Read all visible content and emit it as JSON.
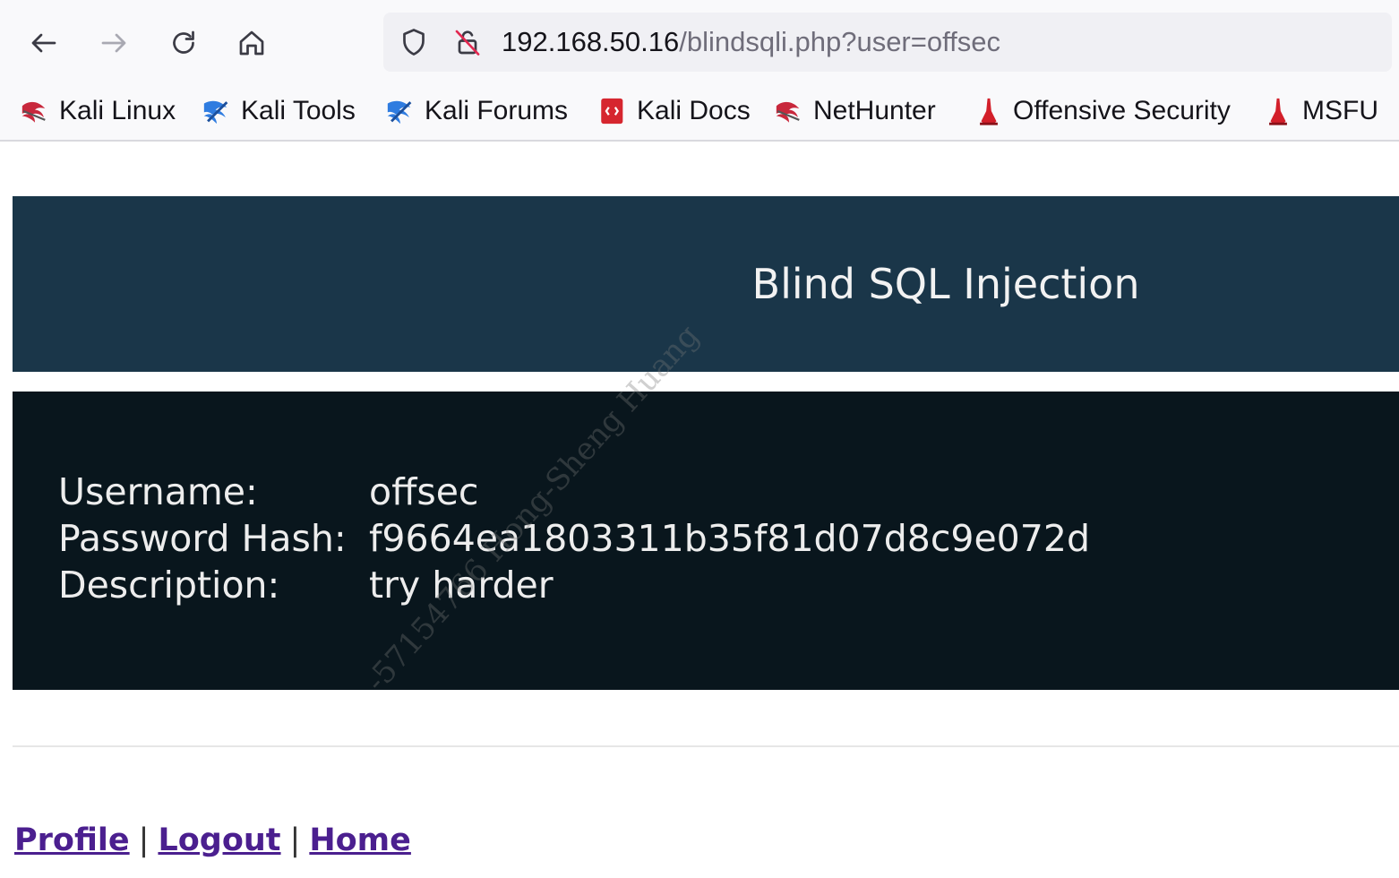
{
  "browser": {
    "url_host": "192.168.50.16",
    "url_path": "/blindsqli.php?user=offsec",
    "bookmarks": [
      {
        "label": "Kali Linux",
        "icon": "kali-dragon-icon"
      },
      {
        "label": "Kali Tools",
        "icon": "kali-tools-icon"
      },
      {
        "label": "Kali Forums",
        "icon": "kali-forums-icon"
      },
      {
        "label": "Kali Docs",
        "icon": "kali-docs-icon"
      },
      {
        "label": "NetHunter",
        "icon": "kali-dragon-icon"
      },
      {
        "label": "Offensive Security",
        "icon": "offsec-icon"
      },
      {
        "label": "MSFU",
        "icon": "offsec-icon"
      }
    ]
  },
  "page": {
    "title": "Blind SQL Injection",
    "fields": [
      {
        "label": "Username:",
        "value": "offsec"
      },
      {
        "label": "Password Hash:",
        "value": "f9664ea1803311b35f81d07d8c9e072d"
      },
      {
        "label": "Description:",
        "value": "try harder"
      }
    ],
    "links": {
      "profile": "Profile",
      "logout": "Logout",
      "home": "Home",
      "separator": "|"
    },
    "watermark": "-57154766 Hong-Sheng Huang"
  },
  "colors": {
    "banner": "#1a3649",
    "panel": "#09161d",
    "link": "#4b1f8f"
  }
}
